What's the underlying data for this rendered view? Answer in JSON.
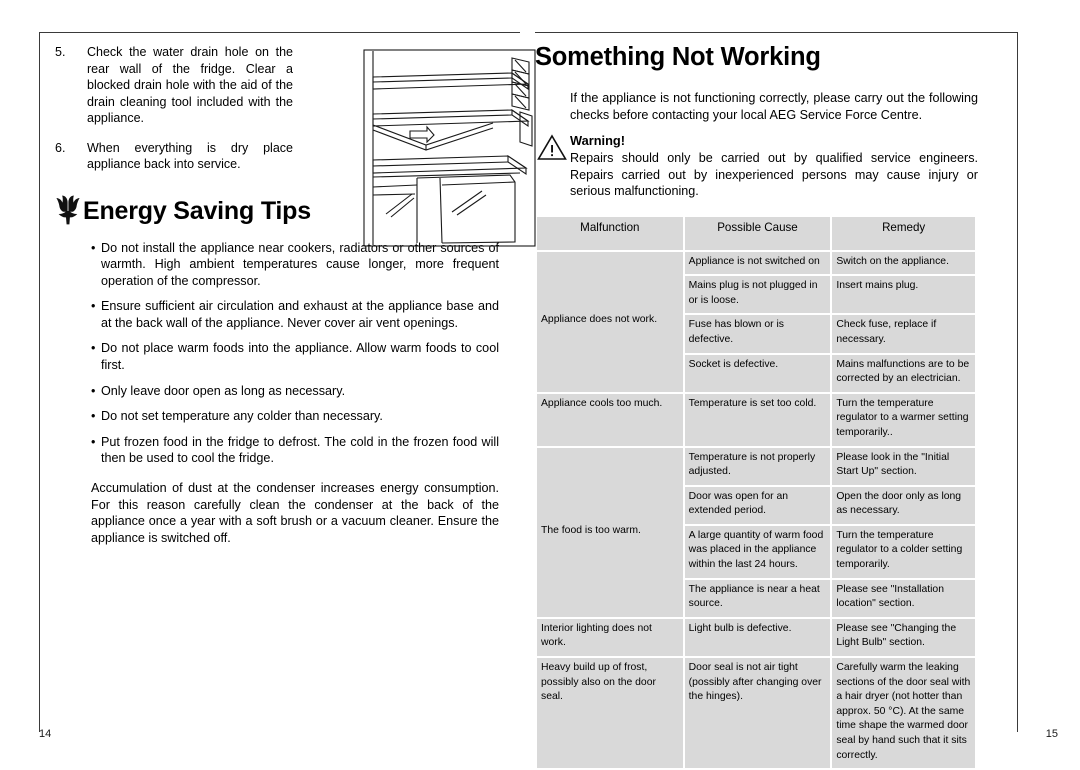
{
  "left_page": {
    "page_number": "14",
    "steps": [
      {
        "number": "5.",
        "text": "Check the water drain hole on the rear wall of the fridge. Clear a blocked drain hole with the aid of the drain cleaning tool included with the appliance."
      },
      {
        "number": "6.",
        "text": "When everything is dry place appliance back into service."
      }
    ],
    "illustration_name": "fridge-interior-drain-hole-diagram",
    "energy_section": {
      "icon": "flower-icon",
      "title": "Energy Saving Tips",
      "bullet": "•",
      "tips": [
        "Do not install the appliance near cookers, radiators or other sources of warmth. High ambient temperatures cause longer, more frequent operation of the compressor.",
        "Ensure sufficient air circulation and exhaust at the appliance base and at the back wall of the appliance. Never cover air vent openings.",
        "Do not place warm foods into the appliance. Allow warm foods to cool first.",
        "Only leave door open as long as necessary.",
        "Do not set temperature any colder than necessary.",
        "Put frozen food in the fridge to defrost. The cold in the frozen food will then be used to cool the fridge."
      ],
      "closing_paragraph": "Accumulation of dust at the condenser increases energy consumption. For this reason carefully clean the condenser at the back of the appliance once a year with a soft brush or a vacuum cleaner. Ensure the appliance is switched off."
    }
  },
  "right_page": {
    "page_number": "15",
    "title": "Something Not Working",
    "intro": "If the appliance is not functioning correctly, please carry out the following checks before contacting your local AEG Service Force Centre.",
    "warning": {
      "icon": "warning-triangle-icon",
      "label": "Warning!",
      "text": "Repairs should only be carried out by qualified service engineers. Repairs carried out by inexperienced persons may cause injury or serious malfunctioning."
    },
    "table": {
      "headers": [
        "Malfunction",
        "Possible Cause",
        "Remedy"
      ],
      "groups": [
        {
          "malfunction": "Appliance does not work.",
          "rows": [
            {
              "cause": "Appliance is not switched on",
              "remedy": "Switch on the appliance."
            },
            {
              "cause": "Mains plug is not plugged in or is loose.",
              "remedy": "Insert mains plug."
            },
            {
              "cause": "Fuse has blown or is defective.",
              "remedy": "Check fuse, replace if necessary."
            },
            {
              "cause": "Socket is defective.",
              "remedy": "Mains malfunctions are to be corrected by an electrician."
            }
          ]
        },
        {
          "malfunction": "Appliance cools too much.",
          "rows": [
            {
              "cause": "Temperature is set too cold.",
              "remedy": "Turn the temperature regulator to a warmer setting temporarily.."
            }
          ]
        },
        {
          "malfunction": "The food is too warm.",
          "rows": [
            {
              "cause": "Temperature is not properly adjusted.",
              "remedy": "Please look in the \"Initial Start Up\" section."
            },
            {
              "cause": "Door was open for an extended period.",
              "remedy": "Open the door only as long as necessary."
            },
            {
              "cause": "A large quantity of warm food was placed in the appliance within the last 24 hours.",
              "remedy": "Turn the temperature regulator to a colder setting temporarily."
            },
            {
              "cause": "The appliance is near a heat source.",
              "remedy": "Please see \"Installation location\" section."
            }
          ]
        },
        {
          "malfunction": "Interior lighting does not work.",
          "rows": [
            {
              "cause": "Light bulb is defective.",
              "remedy": "Please see \"Changing the Light Bulb\" section."
            }
          ]
        },
        {
          "malfunction": "Heavy build up of frost, possibly also on the door seal.",
          "rows": [
            {
              "cause": "Door seal is not air tight (possibly after changing over the hinges).",
              "remedy": "Carefully warm the leaking sections of the door seal with a hair dryer (not hotter than approx. 50 °C). At the same time shape the warmed door seal by hand such that it sits correctly."
            }
          ]
        }
      ]
    }
  },
  "colors": {
    "cell_background": "#d9d9d9",
    "rule": "#3a3a3a",
    "text": "#000000"
  }
}
